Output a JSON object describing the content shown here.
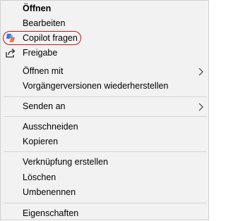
{
  "menu": {
    "items": [
      {
        "label": "Öffnen",
        "bold": true
      },
      {
        "label": "Bearbeiten"
      },
      {
        "label": "Copilot fragen",
        "icon": "copilot-icon"
      },
      {
        "label": "Freigabe",
        "icon": "share-icon"
      },
      {
        "label": "Öffnen mit",
        "submenu": true
      },
      {
        "label": "Vorgängerversionen wiederherstellen"
      },
      {
        "label": "Senden an",
        "submenu": true
      },
      {
        "label": "Ausschneiden"
      },
      {
        "label": "Kopieren"
      },
      {
        "label": "Verknüpfung erstellen"
      },
      {
        "label": "Löschen"
      },
      {
        "label": "Umbenennen"
      },
      {
        "label": "Eigenschaften"
      }
    ]
  },
  "colors": {
    "background": "#f2f2f2",
    "separator": "#d6d6d6",
    "highlight": "#c0161c"
  }
}
